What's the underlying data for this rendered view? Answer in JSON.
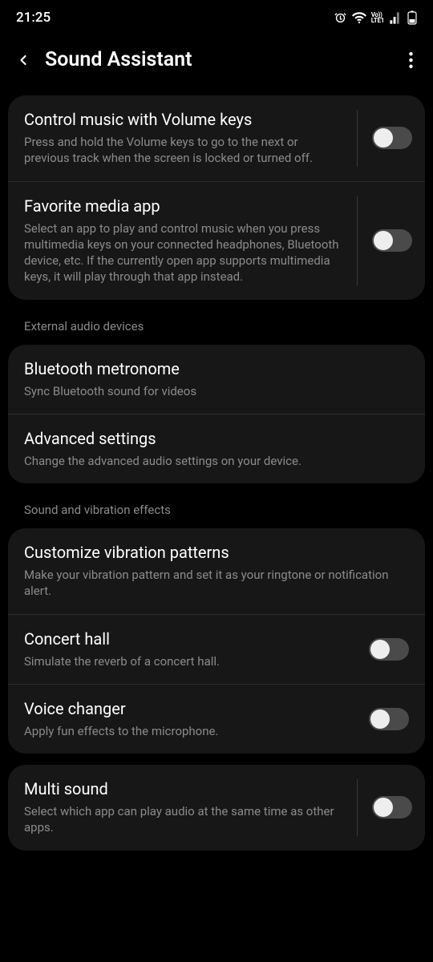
{
  "status": {
    "time": "21:25",
    "icons": {
      "alarm": "alarm-icon",
      "wifi": "wifi-icon",
      "volte": "VoLTE1",
      "signal": "signal-icon",
      "battery": "battery-icon"
    }
  },
  "header": {
    "title": "Sound Assistant"
  },
  "groups": [
    {
      "items": [
        {
          "title": "Control music with Volume keys",
          "desc": "Press and hold the Volume keys to go to the next or previous track when the screen is locked or turned off.",
          "toggle": false,
          "separator": true
        },
        {
          "title": "Favorite media app",
          "desc": "Select an app to play and control music when you press multimedia keys on your connected headphones, Bluetooth device, etc. If the currently open app supports multimedia keys, it will play through that app instead.",
          "toggle": false,
          "separator": true
        }
      ]
    },
    {
      "label": "External audio devices",
      "items": [
        {
          "title": "Bluetooth metronome",
          "desc": "Sync Bluetooth sound for videos"
        },
        {
          "title": "Advanced settings",
          "desc": "Change the advanced audio settings on your device."
        }
      ]
    },
    {
      "label": "Sound and vibration effects",
      "items": [
        {
          "title": "Customize vibration patterns",
          "desc": "Make your vibration pattern and set it as your ringtone or notification alert."
        },
        {
          "title": "Concert hall",
          "desc": "Simulate the reverb of a concert hall.",
          "toggle": false
        },
        {
          "title": "Voice changer",
          "desc": "Apply fun effects to the microphone.",
          "toggle": false
        }
      ]
    },
    {
      "items": [
        {
          "title": "Multi sound",
          "desc": "Select which app can play audio at the same time as other apps.",
          "toggle": false,
          "separator": true
        }
      ]
    }
  ]
}
